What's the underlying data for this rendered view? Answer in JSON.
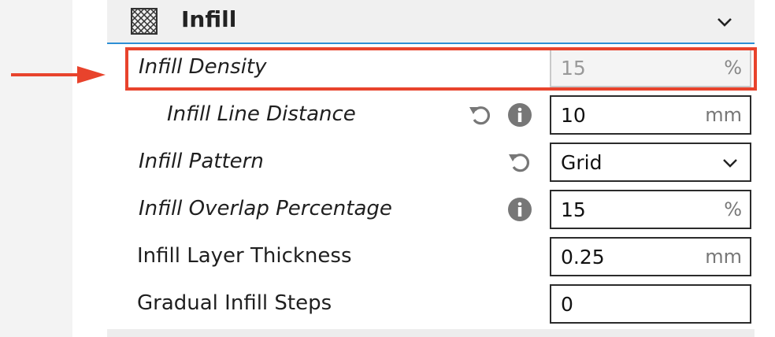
{
  "section": {
    "title": "Infill",
    "icon": "infill-grid-icon",
    "expand_icon": "chevron-down-icon"
  },
  "annotation": {
    "arrow_color": "#e8432c",
    "highlight_color": "#e8432c"
  },
  "settings": [
    {
      "label": "Infill Density",
      "value": "15",
      "unit": "%",
      "italic": true,
      "indent": false,
      "disabled": true,
      "reset": false,
      "info": false
    },
    {
      "label": "Infill Line Distance",
      "value": "10",
      "unit": "mm",
      "italic": true,
      "indent": true,
      "disabled": false,
      "reset": true,
      "info": true
    },
    {
      "label": "Infill Pattern",
      "value": "Grid",
      "unit": "",
      "italic": true,
      "indent": false,
      "disabled": false,
      "reset": true,
      "info": false,
      "dropdown": true
    },
    {
      "label": "Infill Overlap Percentage",
      "value": "15",
      "unit": "%",
      "italic": true,
      "indent": false,
      "disabled": false,
      "reset": false,
      "info": true
    },
    {
      "label": "Infill Layer Thickness",
      "value": "0.25",
      "unit": "mm",
      "italic": false,
      "indent": false,
      "disabled": false,
      "reset": false,
      "info": false
    },
    {
      "label": "Gradual Infill Steps",
      "value": "0",
      "unit": "",
      "italic": false,
      "indent": false,
      "disabled": false,
      "reset": false,
      "info": false
    }
  ]
}
